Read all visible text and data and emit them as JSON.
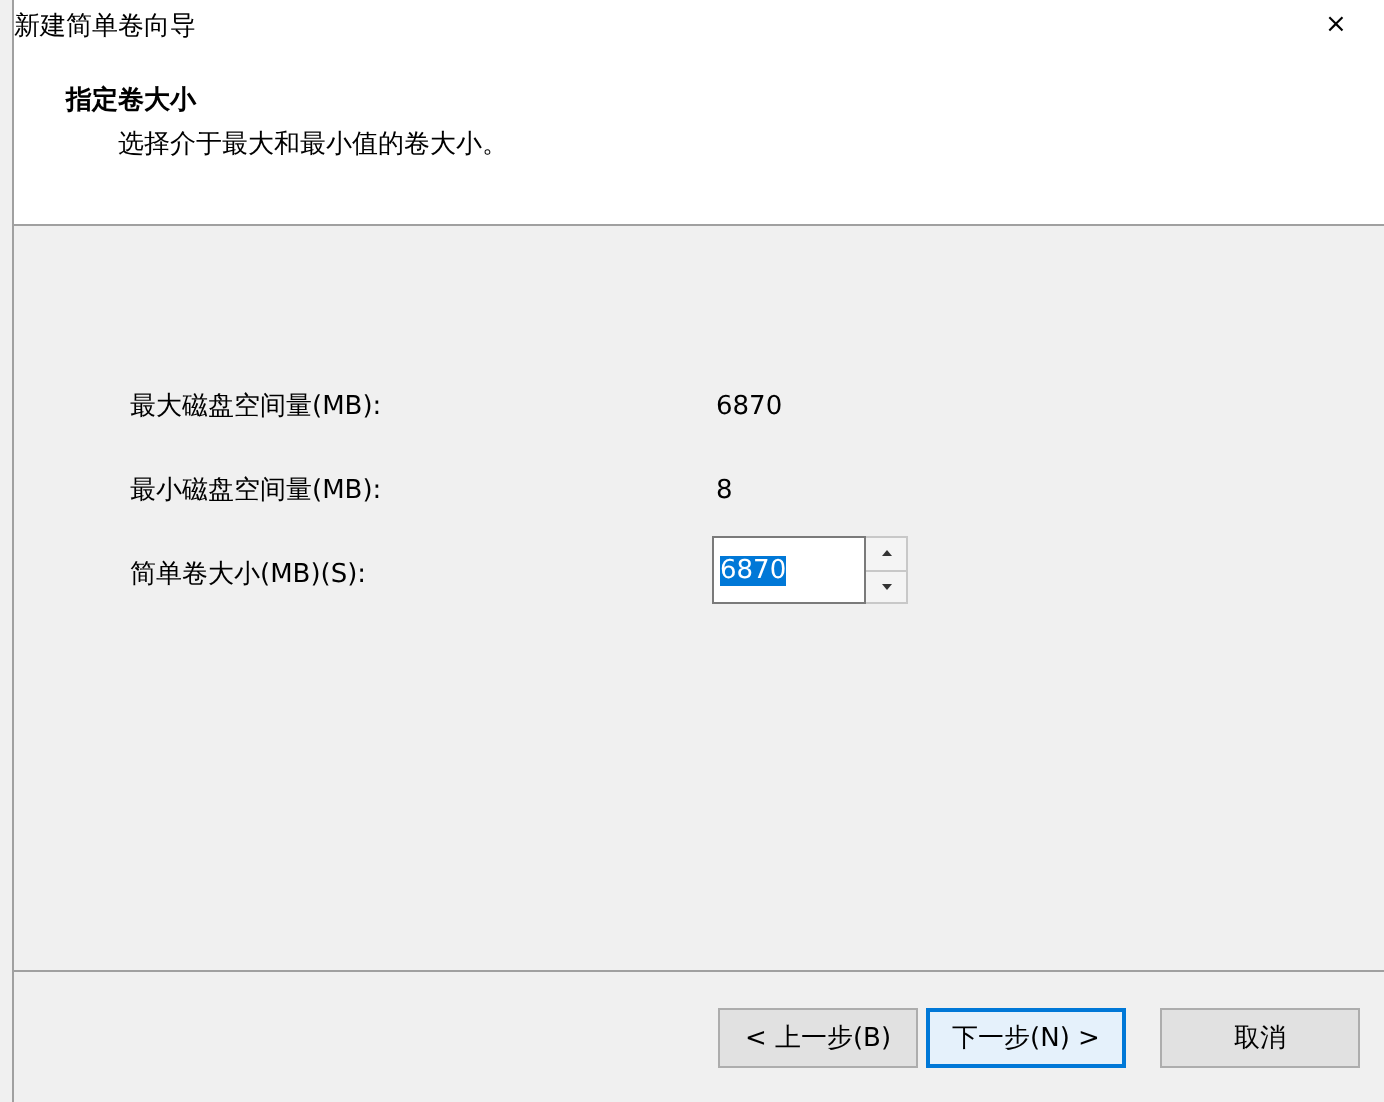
{
  "window": {
    "title": "新建简单卷向导",
    "close": "×"
  },
  "header": {
    "title": "指定卷大小",
    "subtitle": "选择介于最大和最小值的卷大小。"
  },
  "fields": [
    {
      "kind": "readout",
      "label": "最大磁盘空间量(MB):",
      "value": "6870"
    },
    {
      "kind": "readout",
      "label": "最小磁盘空间量(MB):",
      "value": "8"
    },
    {
      "kind": "spin",
      "label": "简单卷大小(MB)(S):",
      "value": "6870",
      "value_selected": true
    }
  ],
  "buttons": [
    {
      "label": "< 上一步(B)",
      "focused": false
    },
    {
      "label": "下一步(N) >",
      "focused": true
    },
    {
      "label": "取消",
      "focused": false
    }
  ]
}
